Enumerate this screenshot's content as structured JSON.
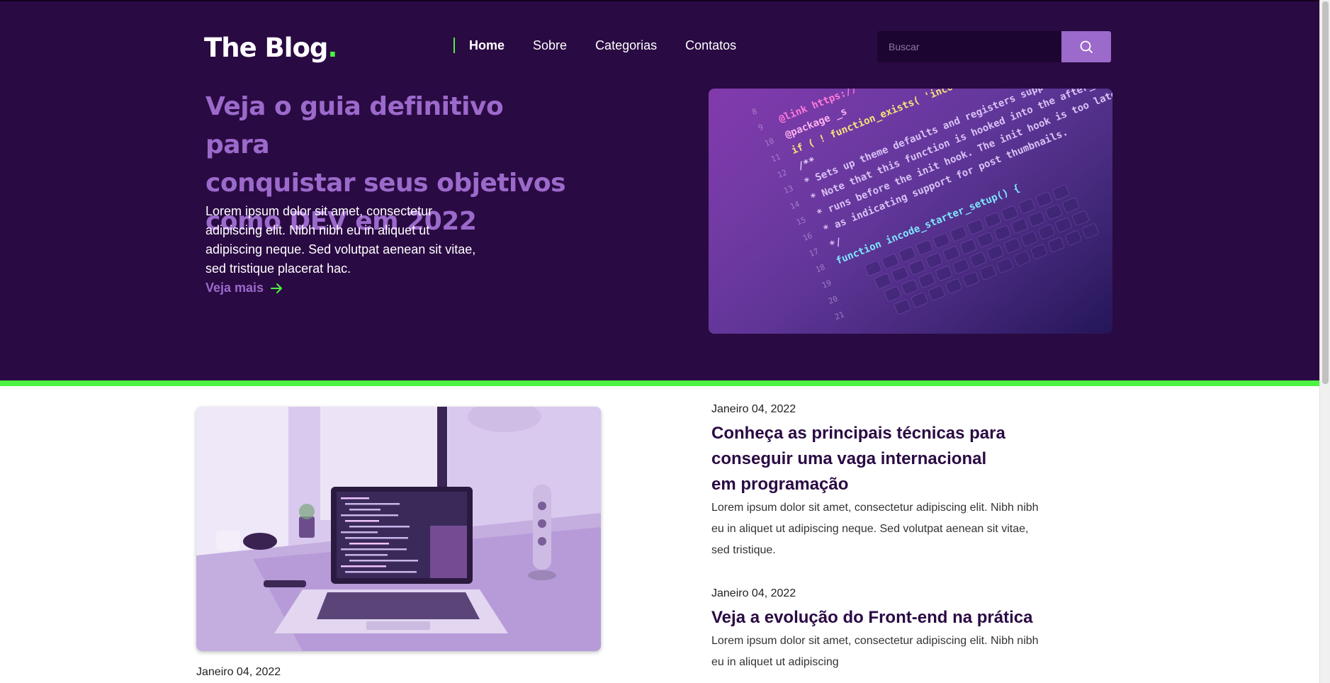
{
  "header": {
    "logo_text": "The Blog",
    "logo_dot": ".",
    "nav": [
      {
        "label": "Home",
        "active": true
      },
      {
        "label": "Sobre",
        "active": false
      },
      {
        "label": "Categorias",
        "active": false
      },
      {
        "label": "Contatos",
        "active": false
      }
    ],
    "search": {
      "placeholder": "Buscar",
      "value": "",
      "button_icon": "search-icon"
    }
  },
  "hero": {
    "title_lines": [
      "Veja o guia definitivo para",
      "conquistar seus objetivos",
      "como DEV em 2022"
    ],
    "text_lines": [
      "Lorem ipsum dolor sit amet, consectetur",
      "adipiscing elit. Nibh nibh eu in aliquet ut",
      "adipiscing neque. Sed volutpat aenean sit vitae,",
      "sed tristique placerat hac."
    ],
    "link_label": "Veja mais",
    "link_icon": "arrow-right-icon",
    "image_code_lines": [
      "@link https://",
      "@package _s",
      "if ( ! function_exists( 'incode_starter_setup' ) ) :",
      "/**",
      "* Sets up theme defaults and registers support for various WordPress features.",
      "* Note that this function is hooked into the after_setup_theme hook, which",
      "* runs before the init hook. The init hook is too late for some features, such",
      "* as indicating support for post thumbnails.",
      "*/",
      "function incode_starter_setup() {"
    ],
    "image_line_numbers": [
      "8",
      "9",
      "10",
      "11",
      "12",
      "13",
      "14",
      "15",
      "16",
      "17",
      "18",
      "19",
      "20",
      "21"
    ]
  },
  "posts": [
    {
      "date": "Janeiro 04, 2022",
      "title_lines": [
        "Conheça as principais técnicas para",
        "conseguir uma vaga internacional",
        "em programação"
      ],
      "text_lines": [
        "Lorem ipsum dolor sit amet, consectetur adipiscing elit. Nibh nibh",
        "eu in aliquet ut adipiscing neque. Sed volutpat aenean sit vitae,",
        "sed tristique."
      ]
    },
    {
      "date": "Janeiro 04, 2022",
      "title_lines": [
        "Veja a evolução do Front-end na prática"
      ],
      "text_lines": [
        "Lorem ipsum dolor sit amet, consectetur adipiscing elit. Nibh nibh",
        "eu in aliquet ut adipiscing"
      ]
    }
  ],
  "featured_post": {
    "date": "Janeiro 04, 2022"
  },
  "colors": {
    "hero_bg": "#2a0a43",
    "accent_green": "#4cf241",
    "accent_purple": "#9b6acb",
    "title_dark": "#2a0a43"
  }
}
